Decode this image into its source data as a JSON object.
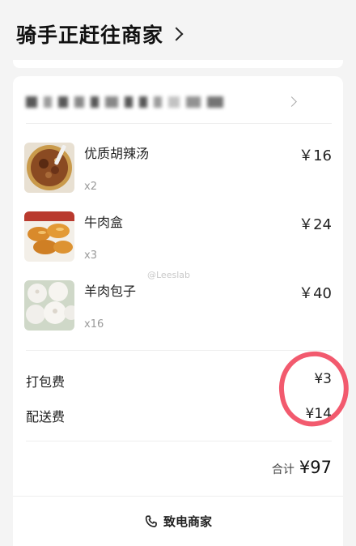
{
  "header": {
    "title": "骑手正赶往商家"
  },
  "items": [
    {
      "name": "优质胡辣汤",
      "qty": "x2",
      "price": "￥16",
      "icon": "soup-photo"
    },
    {
      "name": "牛肉盒",
      "qty": "x3",
      "price": "￥24",
      "icon": "fried-pastry-photo"
    },
    {
      "name": "羊肉包子",
      "qty": "x16",
      "price": "￥40",
      "icon": "steamed-bun-photo"
    }
  ],
  "fees": {
    "packing_label": "打包费",
    "packing_value": "¥3",
    "delivery_label": "配送费",
    "delivery_value": "¥14"
  },
  "total": {
    "label": "合计",
    "value": "¥97"
  },
  "call": {
    "label": "致电商家",
    "icon": "phone-icon"
  },
  "watermark": "@Leeslab",
  "colors": {
    "annotation": "#f25a6e",
    "background": "#f4f4f4"
  }
}
